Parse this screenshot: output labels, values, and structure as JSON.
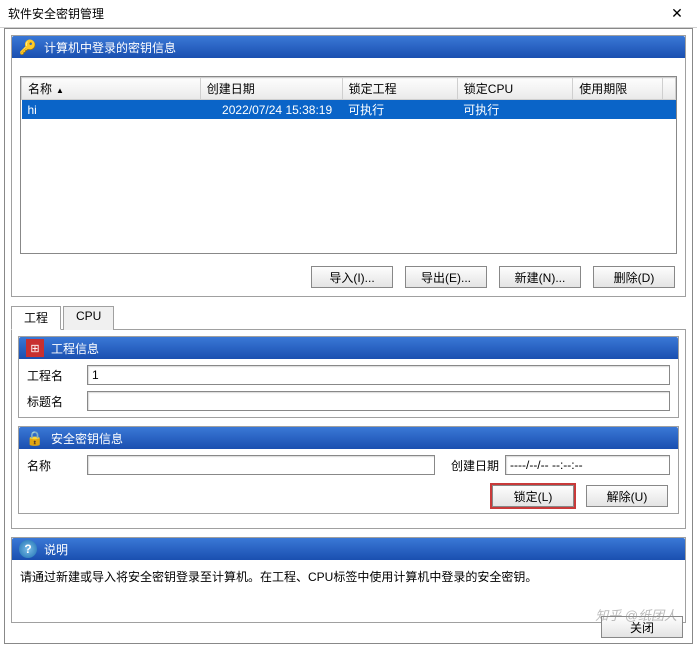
{
  "window": {
    "title": "软件安全密钥管理"
  },
  "key_list": {
    "header_title": "计算机中登录的密钥信息",
    "columns": {
      "name": "名称",
      "created": "创建日期",
      "lock_proj": "锁定工程",
      "lock_cpu": "锁定CPU",
      "period": "使用期限"
    },
    "rows": [
      {
        "name": "hi",
        "created": "2022/07/24 15:38:19",
        "lock_proj": "可执行",
        "lock_cpu": "可执行",
        "period": ""
      }
    ],
    "buttons": {
      "import": "导入(I)...",
      "export": "导出(E)...",
      "new": "新建(N)...",
      "delete": "删除(D)"
    }
  },
  "tabs": {
    "project": "工程",
    "cpu": "CPU"
  },
  "project_info": {
    "header": "工程信息",
    "name_label": "工程名",
    "name_value": "1",
    "title_label": "标题名",
    "title_value": ""
  },
  "sec_info": {
    "header": "安全密钥信息",
    "name_label": "名称",
    "name_value": "",
    "created_label": "创建日期",
    "created_value": "----/--/-- --:--:--",
    "buttons": {
      "lock": "锁定(L)",
      "unlock": "解除(U)"
    }
  },
  "help": {
    "header": "说明",
    "text": "请通过新建或导入将安全密钥登录至计算机。在工程、CPU标签中使用计算机中登录的安全密钥。"
  },
  "footer": {
    "close": "关闭"
  },
  "watermark": "知乎 @纸团人"
}
